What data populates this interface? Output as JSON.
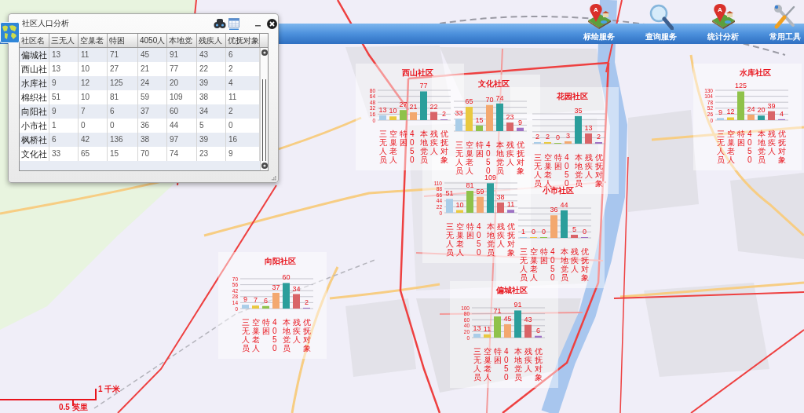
{
  "toolbar": {
    "buttons": [
      {
        "kind": "pin_map",
        "label": "标绘服务",
        "pin_letter": "A"
      },
      {
        "kind": "search",
        "label": "查询服务"
      },
      {
        "kind": "pin_map",
        "label": "统计分析",
        "pin_letter": "A"
      },
      {
        "kind": "tools",
        "label": "常用工具"
      }
    ]
  },
  "panel": {
    "title": "社区人口分析",
    "table": {
      "columns": [
        "社区名",
        "三无人",
        "空巢老",
        "特困",
        "4050人",
        "本地党",
        "残疾人",
        "优抚对象"
      ],
      "rows": [
        [
          "偏城社",
          "13",
          "11",
          "71",
          "45",
          "91",
          "43",
          "6"
        ],
        [
          "西山社",
          "13",
          "10",
          "27",
          "21",
          "77",
          "22",
          "2"
        ],
        [
          "水库社",
          "9",
          "12",
          "125",
          "24",
          "20",
          "39",
          "4"
        ],
        [
          "棉织社",
          "51",
          "10",
          "81",
          "59",
          "109",
          "38",
          "11"
        ],
        [
          "向阳社",
          "9",
          "7",
          "6",
          "37",
          "60",
          "34",
          "2"
        ],
        [
          "小市社",
          "1",
          "0",
          "0",
          "36",
          "44",
          "5",
          "0"
        ],
        [
          "枫桥社",
          "6",
          "42",
          "136",
          "38",
          "97",
          "39",
          "16"
        ],
        [
          "文化社",
          "33",
          "65",
          "15",
          "70",
          "74",
          "23",
          "9"
        ]
      ]
    }
  },
  "community_charts": [
    {
      "chart_data": {
        "type": "bar",
        "title": "西山社区",
        "categories": [
          "三无人员",
          "空巢老人",
          "特困",
          "4050",
          "本地党员",
          "残疾人",
          "优抚对象"
        ],
        "values": [
          13,
          10,
          27,
          21,
          77,
          22,
          2
        ],
        "ylim": [
          0,
          80
        ],
        "yticks": [
          0,
          16,
          32,
          48,
          64,
          80
        ],
        "grid": true,
        "data_labels": true
      }
    },
    {
      "chart_data": {
        "type": "bar",
        "title": "文化社区",
        "categories": [
          "三无人员",
          "空巢老人",
          "特困",
          "4050",
          "本地党员",
          "残疾人",
          "优抚对象"
        ],
        "values": [
          33,
          65,
          15,
          70,
          74,
          23,
          9
        ],
        "grid": true,
        "data_labels": true
      }
    },
    {
      "chart_data": {
        "type": "bar",
        "title": "花园社区",
        "categories": [
          "三无人员",
          "空巢老人",
          "特困",
          "4050",
          "本地党员",
          "残疾人",
          "优抚对象"
        ],
        "values": [
          2,
          2,
          0,
          3,
          35,
          13,
          2
        ],
        "grid": true,
        "data_labels": true
      }
    },
    {
      "chart_data": {
        "type": "bar",
        "title": "水库社区",
        "categories": [
          "三无人员",
          "空巢老人",
          "特困",
          "4050",
          "本地党员",
          "残疾人",
          "优抚对象"
        ],
        "values": [
          9,
          12,
          125,
          24,
          20,
          39,
          4
        ],
        "ylim": [
          0,
          130
        ],
        "yticks": [
          0,
          26,
          52,
          78,
          104,
          130
        ],
        "grid": true,
        "data_labels": true
      }
    },
    {
      "chart_data": {
        "type": "bar",
        "categories": [
          "三无人员",
          "空巢老人",
          "特困",
          "4050",
          "本地党员",
          "残疾人",
          "优抚对象"
        ],
        "values": [
          51,
          10,
          81,
          59,
          109,
          38,
          11
        ],
        "ylim": [
          0,
          110
        ],
        "yticks": [
          0,
          22,
          44,
          66,
          88,
          110
        ],
        "grid": true,
        "data_labels": true
      }
    },
    {
      "chart_data": {
        "type": "bar",
        "title": "小市社区",
        "categories": [
          "三无人员",
          "空巢老人",
          "特困",
          "4050",
          "本地党员",
          "残疾人",
          "优抚对象"
        ],
        "values": [
          1,
          0,
          0,
          36,
          44,
          5,
          0
        ],
        "grid": true,
        "data_labels": true
      }
    },
    {
      "chart_data": {
        "type": "bar",
        "title": "向阳社区",
        "categories": [
          "三无人员",
          "空巢老人",
          "特困",
          "4050",
          "本地党员",
          "残疾人",
          "优抚对象"
        ],
        "values": [
          9,
          7,
          6,
          37,
          60,
          34,
          2
        ],
        "ylim": [
          0,
          70
        ],
        "yticks": [
          0,
          14,
          28,
          42,
          56,
          70
        ],
        "grid": true,
        "data_labels": true
      }
    },
    {
      "chart_data": {
        "type": "bar",
        "title": "偏城社区",
        "categories": [
          "三无人员",
          "空巢老人",
          "特困",
          "4050",
          "本地党员",
          "残疾人",
          "优抚对象"
        ],
        "values": [
          13,
          11,
          71,
          45,
          91,
          43,
          6
        ],
        "ylim": [
          0,
          100
        ],
        "yticks": [
          0,
          20,
          40,
          60,
          80,
          100
        ],
        "grid": true,
        "data_labels": true
      }
    }
  ],
  "scale_bar": {
    "metric": "1 千米",
    "imperial": "0.5 英里"
  }
}
